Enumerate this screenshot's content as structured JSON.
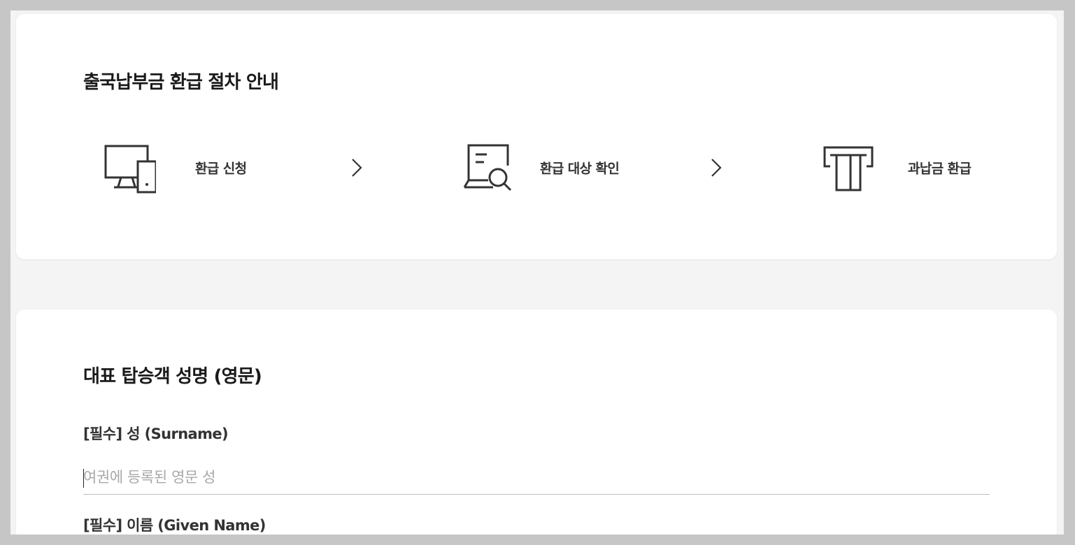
{
  "refund_steps": {
    "title": "출국납부금 환급 절차 안내",
    "steps": [
      {
        "label": "환급 신청",
        "icon": "monitor-device-icon"
      },
      {
        "label": "환급 대상 확인",
        "icon": "document-search-icon"
      },
      {
        "label": "과납금 환급",
        "icon": "atm-card-icon"
      }
    ],
    "arrow_icon": "chevron-right-icon"
  },
  "passenger_form": {
    "title": "대표 탑승객 성명 (영문)",
    "surname": {
      "label": "[필수] 성 (Surname)",
      "value": "",
      "placeholder": "여권에 등록된 영문 성"
    },
    "given_name": {
      "label": "[필수] 이름 (Given Name)"
    }
  },
  "colors": {
    "page_background": "#f4f4f4",
    "card": "#ffffff",
    "frame": "#c6c6c6",
    "icon_stroke": "#333333",
    "placeholder": "#a8a8a8",
    "underline": "#bdbdbd"
  }
}
